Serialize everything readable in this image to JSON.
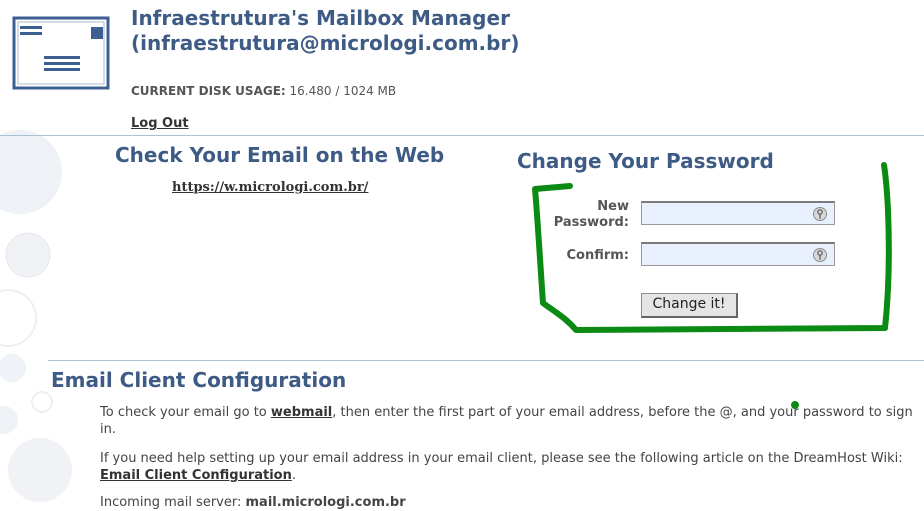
{
  "header": {
    "title_line1": "Infraestrutura's Mailbox Manager",
    "title_line2": "(infraestrutura@micrologi.com.br)",
    "disk_usage_label": "CURRENT DISK USAGE:",
    "disk_usage_value": "16.480 / 1024 MB",
    "logout_label": "Log Out"
  },
  "webmail_section": {
    "heading": "Check Your Email on the Web",
    "url": "https://w.micrologi.com.br/"
  },
  "password_section": {
    "heading": "Change Your Password",
    "new_password_label_line1": "New",
    "new_password_label_line2": "Password:",
    "confirm_label": "Confirm:",
    "new_password_value": "",
    "confirm_value": "",
    "submit_label": "Change it!",
    "field_icon": "key-icon"
  },
  "client_config": {
    "heading": "Email Client Configuration",
    "para1_before": "To check your email go to ",
    "para1_link": "webmail",
    "para1_after": ", then enter the first part of your email address, before the @, and your password to sign in.",
    "para2_before": "If you need help setting up your email address in your email client, please see the following article on the DreamHost Wiki: ",
    "para2_link": "Email Client Configuration",
    "para2_after": ".",
    "para3_label": "Incoming mail server: ",
    "para3_value": "mail.micrologi.com.br"
  },
  "colors": {
    "heading": "#3d5b85",
    "annotation": "#0b8a14",
    "input_bg": "#e8f0fe",
    "divider": "#a9c3d6"
  }
}
